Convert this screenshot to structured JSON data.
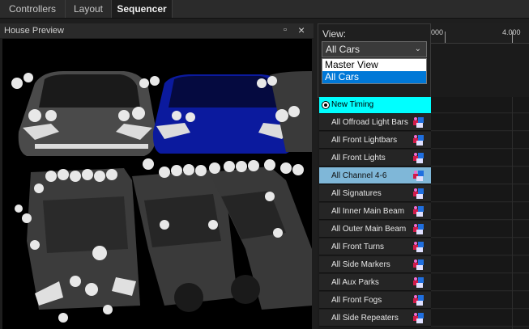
{
  "tabs": [
    {
      "label": "Controllers",
      "active": false
    },
    {
      "label": "Layout",
      "active": false
    },
    {
      "label": "Sequencer",
      "active": true
    }
  ],
  "preview": {
    "title": "House Preview",
    "maximize_glyph": "▫",
    "close_glyph": "×",
    "scene_icon": "car-models-3d-preview"
  },
  "view": {
    "label": "View:",
    "selected": "All Cars",
    "options": [
      {
        "label": "Master View",
        "selected": false
      },
      {
        "label": "All Cars",
        "selected": true
      }
    ]
  },
  "ruler": {
    "ticks": [
      "000",
      "4.000"
    ]
  },
  "timing": {
    "label": "New Timing",
    "color": "#00ffff"
  },
  "models": [
    {
      "label": "All Offroad Light Bars",
      "icon": "group-icon"
    },
    {
      "label": "All Front Lightbars",
      "icon": "group-icon"
    },
    {
      "label": "All Front Lights",
      "icon": "group-icon"
    },
    {
      "label": "All Channel 4-6",
      "icon": "group-icon",
      "selected": true
    },
    {
      "label": "All Signatures",
      "icon": "group-icon"
    },
    {
      "label": "All Inner Main Beam",
      "icon": "group-icon"
    },
    {
      "label": "All Outer Main Beam",
      "icon": "group-icon"
    },
    {
      "label": "All Front Turns",
      "icon": "group-icon"
    },
    {
      "label": "All Side Markers",
      "icon": "group-icon"
    },
    {
      "label": "All Aux Parks",
      "icon": "group-icon"
    },
    {
      "label": "All Front Fogs",
      "icon": "group-icon"
    },
    {
      "label": "All Side Repeaters",
      "icon": "group-icon"
    }
  ],
  "colors": {
    "accent_select": "#0078d7",
    "row_selected": "#7fb7d8",
    "car_blue": "#0b1a9e"
  }
}
